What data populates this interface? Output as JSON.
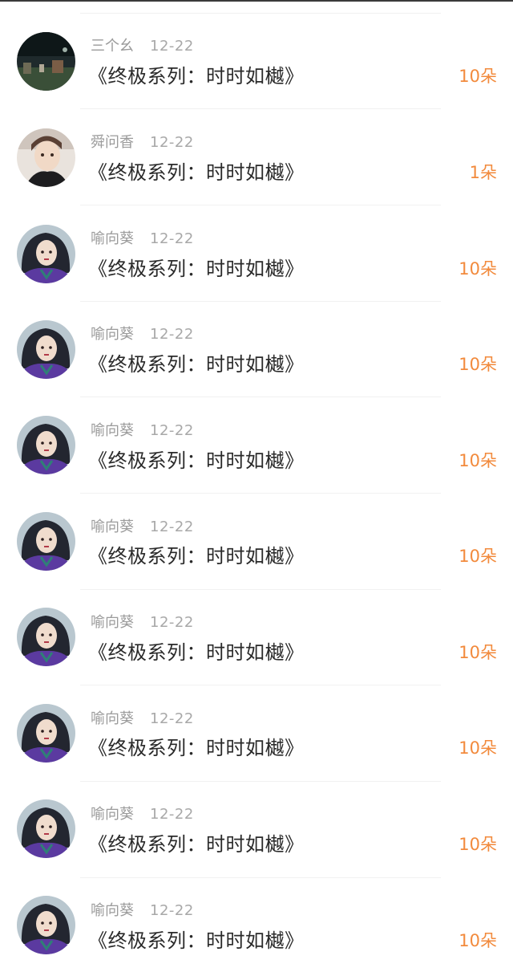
{
  "colors": {
    "accent": "#f28a3c",
    "name_text": "#9b9b9b",
    "gift_text": "#2a2a2a",
    "divider": "#f1f1f1"
  },
  "rows": [
    {
      "name": "三个幺",
      "date": "12-22",
      "gift": "《终极系列：时时如樾》",
      "count": "10朵",
      "avatar": "landscape-avatar"
    },
    {
      "name": "舜问香",
      "date": "12-22",
      "gift": "《终极系列：时时如樾》",
      "count": "1朵",
      "avatar": "selfie-avatar"
    },
    {
      "name": "喻向葵",
      "date": "12-22",
      "gift": "《终极系列：时时如樾》",
      "count": "10朵",
      "avatar": "portrait-avatar"
    },
    {
      "name": "喻向葵",
      "date": "12-22",
      "gift": "《终极系列：时时如樾》",
      "count": "10朵",
      "avatar": "portrait-avatar"
    },
    {
      "name": "喻向葵",
      "date": "12-22",
      "gift": "《终极系列：时时如樾》",
      "count": "10朵",
      "avatar": "portrait-avatar"
    },
    {
      "name": "喻向葵",
      "date": "12-22",
      "gift": "《终极系列：时时如樾》",
      "count": "10朵",
      "avatar": "portrait-avatar"
    },
    {
      "name": "喻向葵",
      "date": "12-22",
      "gift": "《终极系列：时时如樾》",
      "count": "10朵",
      "avatar": "portrait-avatar"
    },
    {
      "name": "喻向葵",
      "date": "12-22",
      "gift": "《终极系列：时时如樾》",
      "count": "10朵",
      "avatar": "portrait-avatar"
    },
    {
      "name": "喻向葵",
      "date": "12-22",
      "gift": "《终极系列：时时如樾》",
      "count": "10朵",
      "avatar": "portrait-avatar"
    },
    {
      "name": "喻向葵",
      "date": "12-22",
      "gift": "《终极系列：时时如樾》",
      "count": "10朵",
      "avatar": "portrait-avatar"
    }
  ]
}
